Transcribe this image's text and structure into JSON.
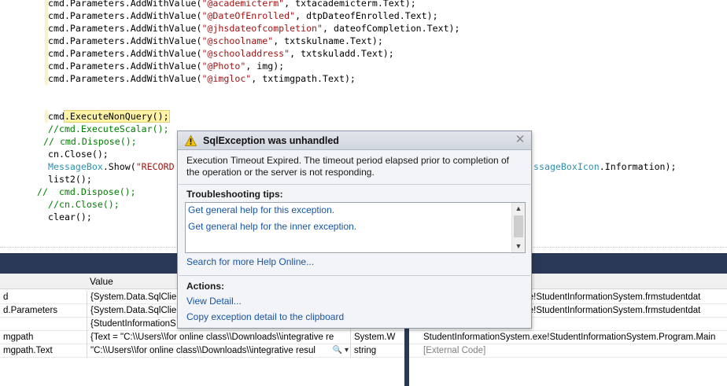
{
  "editor": {
    "lines": [
      {
        "indent": "  ",
        "prefix": "cmd.Parameters.AddWithValue(",
        "str": "\"@academicterm\"",
        "suffix": ", txtacademicterm.Text);"
      },
      {
        "indent": "  ",
        "prefix": "cmd.Parameters.AddWithValue(",
        "str": "\"@DateOfEnrolled\"",
        "suffix": ", dtpDateofEnrolled.Text);"
      },
      {
        "indent": "  ",
        "prefix": "cmd.Parameters.AddWithValue(",
        "str": "\"@jhsdateofcompletion\"",
        "suffix": ", dateofCompletion.Text);"
      },
      {
        "indent": "  ",
        "prefix": "cmd.Parameters.AddWithValue(",
        "str": "\"@schoolname\"",
        "suffix": ", txtskulname.Text);"
      },
      {
        "indent": "  ",
        "prefix": "cmd.Parameters.AddWithValue(",
        "str": "\"@schooladdress\"",
        "suffix": ", txtskuladd.Text);"
      },
      {
        "indent": "  ",
        "prefix": "cmd.Parameters.AddWithValue(",
        "str": "\"@Photo\"",
        "suffix": ", img);"
      },
      {
        "indent": "  ",
        "prefix": "cmd.Parameters.AddWithValue(",
        "str": "\"@imgloc\"",
        "suffix": ", txtimgpath.Text);"
      }
    ],
    "exec_line": {
      "prefix": "cmd",
      "exec": ".ExecuteNonQuery();"
    },
    "comment_lines": [
      "//cmd.ExecuteScalar();",
      "// cmd.Dispose();"
    ],
    "close_line": "cn.Close();",
    "msgbox_line": {
      "type": "MessageBox",
      "prefix": ".Show(",
      "str": "\"RECORD"
    },
    "msgbox_tail": {
      "type": "ssageBoxIcon",
      "suffix": ".Information);"
    },
    "list_line": "list2();",
    "comment_lines_2": [
      "//  cmd.Dispose();",
      "//cn.Close();"
    ],
    "clear_line": "clear();"
  },
  "locals": {
    "header_value": "Value",
    "rows": [
      {
        "name": "d",
        "value": "{System.Data.SqlClien",
        "type": ""
      },
      {
        "name": "d.Parameters",
        "value": "{System.Data.SqlClien",
        "type": ""
      },
      {
        "name": "",
        "value": "{StudentInformationS",
        "type": ""
      },
      {
        "name": "mgpath",
        "value": "{Text = \"C:\\\\Users\\\\for online class\\\\Downloads\\\\integrative re",
        "type": "System.W"
      },
      {
        "name": "mgpath.Text",
        "value": "\"C:\\\\Users\\\\for online class\\\\Downloads\\\\integrative resul",
        "type": "string"
      }
    ]
  },
  "callstack": {
    "rows": [
      {
        "text": "n.exe!StudentInformationSystem.frmstudentdat",
        "external": false
      },
      {
        "text": "n.exe!StudentInformationSystem.frmstudentdat",
        "external": false
      },
      {
        "text": "",
        "external": false
      },
      {
        "text": "StudentInformationSystem.exe!StudentInformationSystem.Program.Main",
        "external": false
      },
      {
        "text": "[External Code]",
        "external": true
      }
    ]
  },
  "dialog": {
    "title": "SqlException was unhandled",
    "message": "Execution Timeout Expired.  The timeout period elapsed prior to completion of the operation or the server is not responding.",
    "tips_title": "Troubleshooting tips:",
    "tips": [
      "Get general help for this exception.",
      "Get general help for the inner exception."
    ],
    "search_link": "Search for more Help Online...",
    "actions_title": "Actions:",
    "actions": [
      "View Detail...",
      "Copy exception detail to the clipboard"
    ],
    "close_glyph": "✕",
    "icon": "warning-icon"
  },
  "colors": {
    "string": "#a31515",
    "comment": "#008000",
    "type": "#2b91af",
    "link": "#1655a8",
    "panel_chrome": "#293955"
  }
}
